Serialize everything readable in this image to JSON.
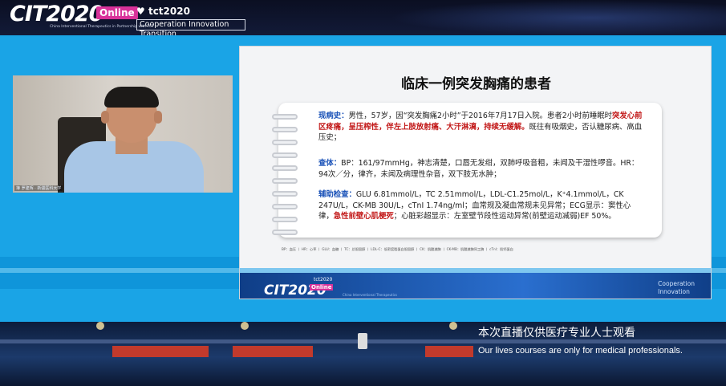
{
  "header": {
    "logo_main": "CIT2020",
    "logo_badge": "Online",
    "logo_subtitle": "China Interventional Therapeutics in Partnership with TCT",
    "partner_logo": "tct2020",
    "tagline": "Cooperation Innovation Transition"
  },
  "speaker": {
    "name_caption": "簿 罗建辉 · 新疆医科大学"
  },
  "slide": {
    "title": "临床一例突发胸痛的患者",
    "history_label": "现病史：",
    "history_text_1": "男性，57岁，因“突发胸痛2小时”于2016年7月17日入院。患者2小时前睡眠时",
    "history_highlight": "突发心前区疼痛，呈压榨性，伴左上肢放射痛、大汗淋漓，持续无缓解。",
    "history_text_2": "既往有吸烟史，否认糖尿病、高血压史；",
    "exam_label": "查体：",
    "exam_text": "BP：161/97mmHg，神志清楚，口唇无发绀，双肺呼吸音粗，未闻及干湿性啰音。HR：94次／分，律齐，未闻及病理性杂音，双下肢无水肿；",
    "aux_label": "辅助检查：",
    "aux_text_1": "GLU 6.81mmol/L，TC 2.51mmol/L，LDL-C1.25mol/L，K⁺4.1mmol/L，CK 247U/L，CK-MB 30U/L，cTnI 1.74ng/ml；血常规及凝血常规未见异常；ECG显示：窦性心律，",
    "aux_highlight": "急性前壁心肌梗死",
    "aux_text_2": "；心脏彩超显示：左室壁节段性运动异常(前壁运动减弱)EF 50%。",
    "abbreviations": "BP：血压 丨 HR：心率 丨 GLU：血糖 丨 TC：总胆固醇 丨 LDL-C：低密度脂蛋白胆固醇 丨 CK：肌酸激酶 丨 CK-MB：肌酸激酶同工酶 丨 cTnI：肌钙蛋白",
    "footer_logo": "CIT2020",
    "footer_badge": "Online",
    "footer_tct": "tct2020",
    "footer_sub": "China Interventional Therapeutics",
    "footer_right_1": "Cooperation",
    "footer_right_2": "Innovation"
  },
  "caption": {
    "chinese": "本次直播仅供医疗专业人士观看",
    "english": "Our lives courses are only for medical professionals."
  },
  "colors": {
    "stage_blue": "#1aa4e6",
    "highlight_red": "#c21818",
    "label_blue": "#1a52b8",
    "online_pink": "#d8329a"
  }
}
